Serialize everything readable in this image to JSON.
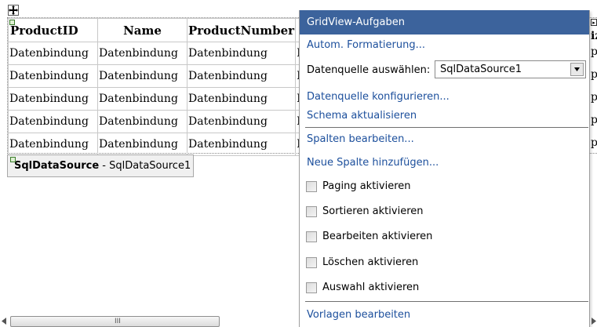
{
  "grid": {
    "columns": [
      "ProductID",
      "Name",
      "ProductNumber",
      ""
    ],
    "rows": [
      [
        "Datenbindung",
        "Datenbindung",
        "Datenbindung",
        "D"
      ],
      [
        "Datenbindung",
        "Datenbindung",
        "Datenbindung",
        "D"
      ],
      [
        "Datenbindung",
        "Datenbindung",
        "Datenbindung",
        "D"
      ],
      [
        "Datenbindung",
        "Datenbindung",
        "Datenbindung",
        "D"
      ],
      [
        "Datenbindung",
        "Datenbindung",
        "Datenbindung",
        "D"
      ]
    ],
    "clipped_right_column": {
      "header": "iz",
      "cells": [
        "pi",
        "pi",
        "pi",
        "pi",
        "pi"
      ]
    }
  },
  "sqldatasource": {
    "type_label": "SqlDataSource",
    "separator": " - ",
    "id_label": "SqlDataSource1"
  },
  "smart_tag_panel": {
    "title": "GridView-Aufgaben",
    "auto_format_link": "Autom. Formatierung...",
    "datasource_label": "Datenquelle auswählen:",
    "datasource_value": "SqlDataSource1",
    "configure_datasource_link": "Datenquelle konfigurieren...",
    "refresh_schema_link": "Schema aktualisieren",
    "edit_columns_link": "Spalten bearbeiten...",
    "add_column_link": "Neue Spalte hinzufügen...",
    "checkboxes": [
      {
        "label": "Paging aktivieren",
        "checked": false
      },
      {
        "label": "Sortieren aktivieren",
        "checked": false
      },
      {
        "label": "Bearbeiten aktivieren",
        "checked": false
      },
      {
        "label": "Löschen aktivieren",
        "checked": false
      },
      {
        "label": "Auswahl aktivieren",
        "checked": false
      }
    ],
    "edit_templates_link": "Vorlagen bearbeiten"
  },
  "scrollbar": {
    "grip_text": "III"
  },
  "colors": {
    "panel_title_bg": "#3c639c",
    "link_color": "#1c4f9c",
    "tag_bg": "#f0f0f0"
  },
  "icons": {
    "move_handle": "move-arrows-icon",
    "dropdown": "chevron-down-icon",
    "glyph": "smart-tag-glyph-icon"
  }
}
